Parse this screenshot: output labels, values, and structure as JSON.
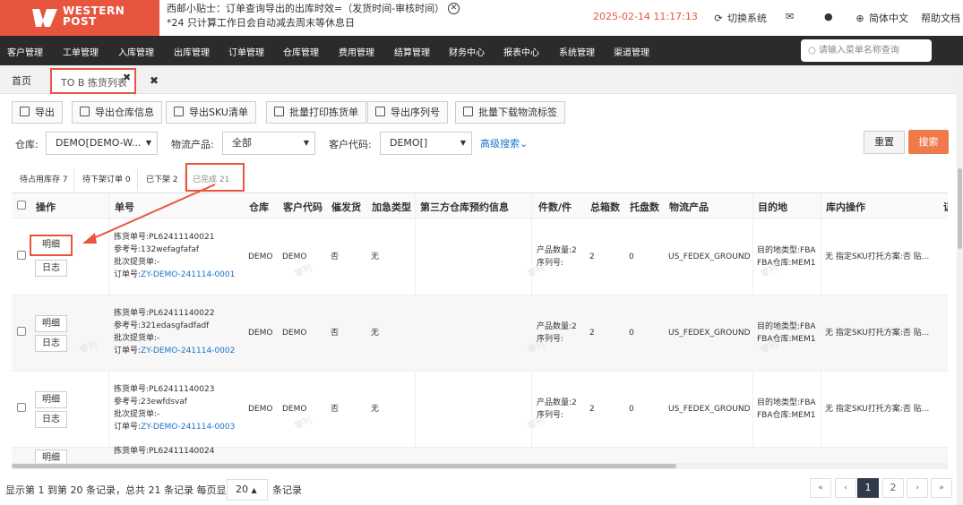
{
  "header": {
    "logo_line1": "WESTERN",
    "logo_line2": "POST",
    "tip_line1": "西邮小贴士：订单查询导出的出库时效=（发货时间-审核时间）",
    "tip_line2": "*24 只计算工作日会自动减去周末等休息日",
    "datetime": "2025-02-14 11:17:13",
    "switch_system": "切换系统",
    "language": "简体中文",
    "help": "帮助文档"
  },
  "nav": {
    "items": [
      "客户管理",
      "工单管理",
      "入库管理",
      "出库管理",
      "订单管理",
      "仓库管理",
      "费用管理",
      "结算管理",
      "财务中心",
      "报表中心",
      "系统管理",
      "渠道管理"
    ],
    "search_placeholder": "请输入菜单名称查询"
  },
  "tabs": {
    "home": "首页",
    "active": "TO B 拣货列表"
  },
  "toolbar": [
    "导出",
    "导出仓库信息",
    "导出SKU清单",
    "批量打印拣货单",
    "导出序列号",
    "批量下载物流标签"
  ],
  "filters": {
    "warehouse_label": "仓库:",
    "warehouse_value": "DEMO[DEMO-W...",
    "product_label": "物流产品:",
    "product_value": "全部",
    "customer_label": "客户代码:",
    "customer_value": "DEMO[]",
    "advanced": "高级搜索",
    "reset": "重置",
    "search": "搜索"
  },
  "status_tabs": [
    "待占用库存 7",
    "待下架订单 0",
    "已下架 2",
    "已完成 21"
  ],
  "table": {
    "headers": [
      "操作",
      "单号",
      "仓库",
      "客户代码",
      "催发货",
      "加急类型",
      "第三方仓库预约信息",
      "件数/件",
      "总箱数",
      "托盘数",
      "物流产品",
      "目的地",
      "库内操作",
      "证"
    ],
    "detail_btn": "明细",
    "log_btn": "日志",
    "rows": [
      {
        "pick_no": "拣货单号:PL62411140021",
        "ref_no": "参考号:132wefagfafaf",
        "batch": "批次提货单:-",
        "order_label": "订单号:",
        "order_no": "ZY-DEMO-241114-0001",
        "warehouse": "DEMO",
        "customer": "DEMO",
        "urge": "否",
        "urgent": "无",
        "qty": "产品数量:2",
        "serial": "序列号:",
        "boxes": "2",
        "pallets": "0",
        "product": "US_FEDEX_GROUND",
        "dest1": "目的地类型:FBA",
        "dest2": "FBA仓库:MEM1",
        "ops": "无 指定SKU打托方案:否 贴..."
      },
      {
        "pick_no": "拣货单号:PL62411140022",
        "ref_no": "参考号:321edasgfadfadf",
        "batch": "批次提货单:-",
        "order_label": "订单号:",
        "order_no": "ZY-DEMO-241114-0002",
        "warehouse": "DEMO",
        "customer": "DEMO",
        "urge": "否",
        "urgent": "无",
        "qty": "产品数量:2",
        "serial": "序列号:",
        "boxes": "2",
        "pallets": "0",
        "product": "US_FEDEX_GROUND",
        "dest1": "目的地类型:FBA",
        "dest2": "FBA仓库:MEM1",
        "ops": "无 指定SKU打托方案:否 贴..."
      },
      {
        "pick_no": "拣货单号:PL62411140023",
        "ref_no": "参考号:23ewfdsvaf",
        "batch": "批次提货单:-",
        "order_label": "订单号:",
        "order_no": "ZY-DEMO-241114-0003",
        "warehouse": "DEMO",
        "customer": "DEMO",
        "urge": "否",
        "urgent": "无",
        "qty": "产品数量:2",
        "serial": "序列号:",
        "boxes": "2",
        "pallets": "0",
        "product": "US_FEDEX_GROUND",
        "dest1": "目的地类型:FBA",
        "dest2": "FBA仓库:MEM1",
        "ops": "无 指定SKU打托方案:否 贴..."
      },
      {
        "pick_no": "拣货单号:PL62411140024",
        "detail_partial": "明细"
      }
    ]
  },
  "footer": {
    "summary": "显示第 1 到第 20 条记录，总共 21 条记录 每页显示",
    "page_size": "20",
    "suffix": "条记录",
    "pages": [
      "«",
      "‹",
      "1",
      "2",
      "›",
      "»"
    ]
  },
  "watermark": "零刊",
  "colors": {
    "brand": "#e8553e",
    "nav_bg": "#2b2b2b",
    "link": "#1a73c8",
    "search_btn": "#f07b4a"
  }
}
